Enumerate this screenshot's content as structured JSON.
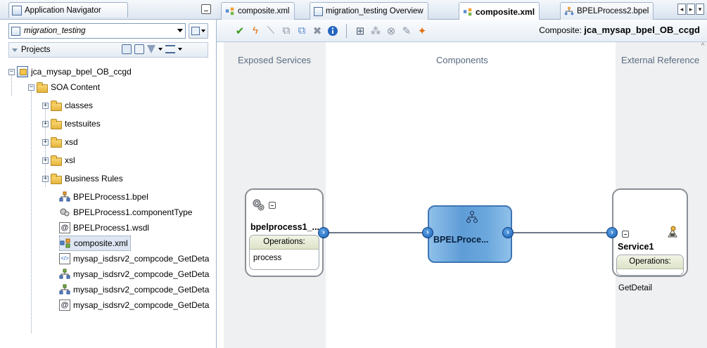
{
  "navigator": {
    "title": "Application Navigator",
    "application": "migration_testing",
    "projects_label": "Projects",
    "tree": {
      "project": "jca_mysap_bpel_OB_ccgd",
      "soa_content": "SOA Content",
      "folders": [
        "classes",
        "testsuites",
        "xsd",
        "xsl",
        "Business Rules"
      ],
      "files": [
        "BPELProcess1.bpel",
        "BPELProcess1.componentType",
        "BPELProcess1.wsdl",
        "composite.xml",
        "mysap_isdsrv2_compcode_GetDeta",
        "mysap_isdsrv2_compcode_GetDeta",
        "mysap_isdsrv2_compcode_GetDeta",
        "mysap_isdsrv2_compcode_GetDeta"
      ]
    }
  },
  "editor": {
    "tabs": [
      "composite.xml",
      "migration_testing Overview",
      "composite.xml",
      "BPELProcess2.bpel"
    ],
    "active_tab_index": 2,
    "composite_label": "Composite:",
    "composite_name": "jca_mysap_bpel_OB_ccgd",
    "columns": {
      "exposed": "Exposed Services",
      "components": "Components",
      "external": "External Reference"
    },
    "service": {
      "name": "bpelprocess1_...",
      "ops_label": "Operations:",
      "op": "process"
    },
    "component": {
      "name": "BPELProce..."
    },
    "reference": {
      "name": "Service1",
      "ops_label": "Operations:",
      "op": "GetDetail"
    }
  },
  "colors": {
    "accent": "#f4a732",
    "component_fill": "#6aa7dd",
    "port": "#1a5fb4"
  }
}
